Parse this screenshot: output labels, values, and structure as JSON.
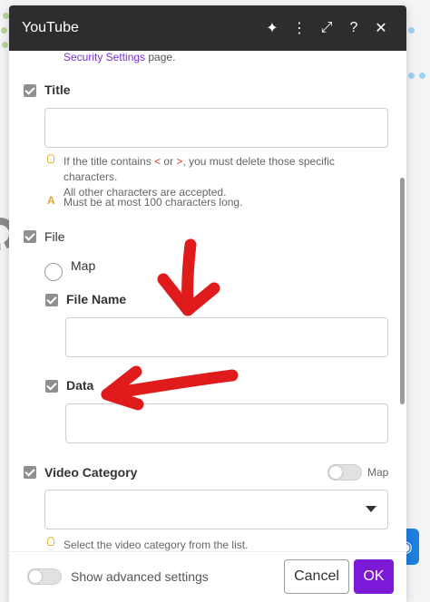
{
  "modal": {
    "title": "YouTube"
  },
  "intro": {
    "link_text": "Security Settings",
    "suffix": " page."
  },
  "title_field": {
    "label": "Title",
    "value": "",
    "hint_pre": "If the title contains ",
    "hint_lt": "<",
    "hint_or": " or ",
    "hint_gt": ">",
    "hint_post": ", you must delete those specific characters.",
    "hint_line2": "All other characters are accepted.",
    "warning": "Must be at most 100 characters long."
  },
  "file_group": {
    "label": "File",
    "map_label": "Map"
  },
  "file_name_field": {
    "label": "File Name",
    "value": ""
  },
  "data_field": {
    "label": "Data",
    "value": ""
  },
  "video_category": {
    "label": "Video Category",
    "map_label": "Map",
    "selected": "",
    "hint": "Select the video category from the list."
  },
  "footer": {
    "advanced_label": "Show advanced settings",
    "cancel_label": "Cancel",
    "ok_label": "OK"
  },
  "icons": {
    "header": [
      "sparkle-icon",
      "kebab-menu-icon",
      "expand-icon",
      "help-icon",
      "close-icon"
    ],
    "annotation_color": "#e01b1b",
    "accent": "#7b19d6"
  }
}
